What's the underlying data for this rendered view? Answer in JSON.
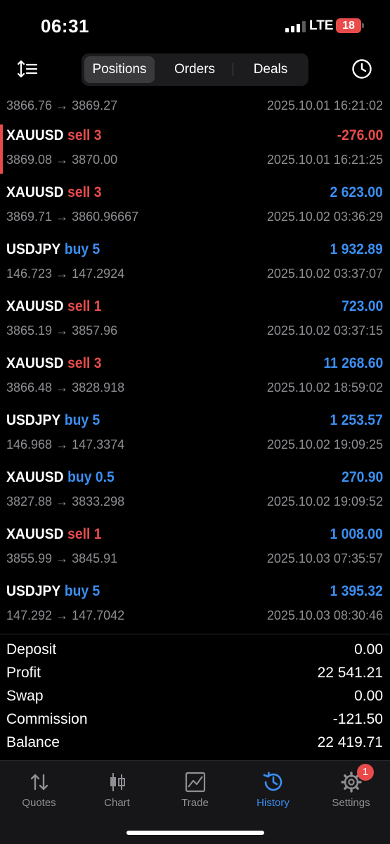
{
  "status_bar": {
    "time": "06:31",
    "network": "LTE",
    "battery": "18"
  },
  "tabs_top": {
    "positions": "Positions",
    "orders": "Orders",
    "deals": "Deals",
    "active": "Deals-history:Positions"
  },
  "partial_row": {
    "prices": "3866.76 → 3869.27",
    "datetime": "2025.10.01 16:21:02"
  },
  "deals": [
    {
      "symbol": "XAUUSD",
      "side": "sell 3",
      "direction": "sell",
      "profit": "-276.00",
      "prices": "3869.08 → 3870.00",
      "datetime": "2025.10.01 16:21:25",
      "highlighted": true
    },
    {
      "symbol": "XAUUSD",
      "side": "sell 3",
      "direction": "sell",
      "profit": "2 623.00",
      "prices": "3869.71 → 3860.96667",
      "datetime": "2025.10.02 03:36:29"
    },
    {
      "symbol": "USDJPY",
      "side": "buy 5",
      "direction": "buy",
      "profit": "1 932.89",
      "prices": "146.723 → 147.2924",
      "datetime": "2025.10.02 03:37:07"
    },
    {
      "symbol": "XAUUSD",
      "side": "sell 1",
      "direction": "sell",
      "profit": "723.00",
      "prices": "3865.19 → 3857.96",
      "datetime": "2025.10.02 03:37:15"
    },
    {
      "symbol": "XAUUSD",
      "side": "sell 3",
      "direction": "sell",
      "profit": "11 268.60",
      "prices": "3866.48 → 3828.918",
      "datetime": "2025.10.02 18:59:02"
    },
    {
      "symbol": "USDJPY",
      "side": "buy 5",
      "direction": "buy",
      "profit": "1 253.57",
      "prices": "146.968 → 147.3374",
      "datetime": "2025.10.02 19:09:25"
    },
    {
      "symbol": "XAUUSD",
      "side": "buy 0.5",
      "direction": "buy",
      "profit": "270.90",
      "prices": "3827.88 → 3833.298",
      "datetime": "2025.10.02 19:09:52"
    },
    {
      "symbol": "XAUUSD",
      "side": "sell 1",
      "direction": "sell",
      "profit": "1 008.00",
      "prices": "3855.99 → 3845.91",
      "datetime": "2025.10.03 07:35:57"
    },
    {
      "symbol": "USDJPY",
      "side": "buy 5",
      "direction": "buy",
      "profit": "1 395.32",
      "prices": "147.292 → 147.7042",
      "datetime": "2025.10.03 08:30:46"
    }
  ],
  "summary": {
    "deposit_label": "Deposit",
    "deposit": "0.00",
    "profit_label": "Profit",
    "profit": "22 541.21",
    "swap_label": "Swap",
    "swap": "0.00",
    "commission_label": "Commission",
    "commission": "-121.50",
    "balance_label": "Balance",
    "balance": "22 419.71"
  },
  "tabbar": {
    "quotes": "Quotes",
    "chart": "Chart",
    "trade": "Trade",
    "history": "History",
    "settings": "Settings",
    "settings_badge": "1"
  },
  "colors": {
    "sell": "#e94b4b",
    "buy": "#3b8ff3",
    "muted": "#8e8e93",
    "background": "#000000"
  },
  "icons": [
    "sort-icon",
    "clock-icon",
    "quotes-icon",
    "chart-icon",
    "trade-icon",
    "history-icon",
    "settings-icon"
  ]
}
